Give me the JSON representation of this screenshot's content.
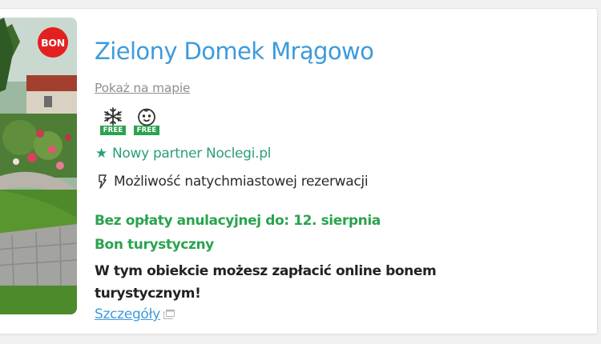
{
  "listing": {
    "badge": "BON",
    "title": "Zielony Domek Mrągowo",
    "map_link": "Pokaż na mapie",
    "amenities": [
      {
        "icon": "air-conditioning-snowflake-icon",
        "badge": "FREE"
      },
      {
        "icon": "baby-face-icon",
        "badge": "FREE"
      }
    ],
    "partner": {
      "icon": "star-icon",
      "text": "Nowy partner Noclegi.pl"
    },
    "instant": {
      "icon": "lightning-icon",
      "text": "Możliwość natychmiastowej rezerwacji"
    },
    "cancellation": "Bez opłaty anulacyjnej do: 12. sierpnia",
    "bon_title": "Bon turystyczny",
    "bon_description": "W tym obiekcie możesz zapłacić online bonem turystycznym!",
    "details_link": "Szczegóły",
    "details_icon": "external-window-icon"
  },
  "colors": {
    "title": "#3d9bdb",
    "green": "#2aa34e",
    "teal": "#2aa077",
    "badge_red": "#e32020"
  }
}
